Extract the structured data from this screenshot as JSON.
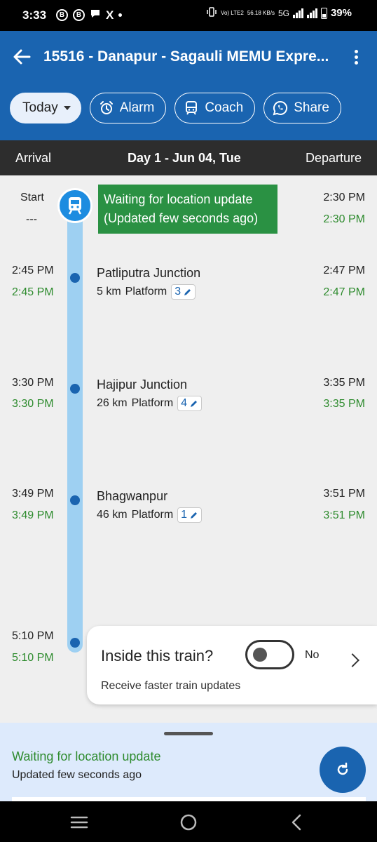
{
  "status_bar": {
    "time": "3:33",
    "network_small": "Vo) LTE2",
    "speed": "56.18 KB/s",
    "network": "5G",
    "battery": "39%"
  },
  "app_bar": {
    "title": "15516 - Danapur - Sagauli MEMU Expre...",
    "chips": {
      "today": "Today",
      "alarm": "Alarm",
      "coach": "Coach",
      "share": "Share"
    }
  },
  "day_header": {
    "arrival": "Arrival",
    "day": "Day 1 - Jun 04, Tue",
    "departure": "Departure"
  },
  "live_status": {
    "line1": "Waiting for location update",
    "line2": "(Updated few seconds ago)"
  },
  "stops": [
    {
      "arr_sched": "Start",
      "arr_actual": "---",
      "dep_sched": "2:30 PM",
      "dep_actual": "2:30 PM"
    },
    {
      "arr_sched": "2:45 PM",
      "arr_actual": "2:45 PM",
      "name": "Patliputra Junction",
      "distance": "5 km",
      "platform_label": "Platform",
      "platform": "3",
      "dep_sched": "2:47 PM",
      "dep_actual": "2:47 PM"
    },
    {
      "arr_sched": "3:30 PM",
      "arr_actual": "3:30 PM",
      "name": "Hajipur Junction",
      "distance": "26 km",
      "platform_label": "Platform",
      "platform": "4",
      "dep_sched": "3:35 PM",
      "dep_actual": "3:35 PM"
    },
    {
      "arr_sched": "3:49 PM",
      "arr_actual": "3:49 PM",
      "name": "Bhagwanpur",
      "distance": "46 km",
      "platform_label": "Platform",
      "platform": "1",
      "dep_sched": "3:51 PM",
      "dep_actual": "3:51 PM"
    },
    {
      "arr_sched": "5:10 PM",
      "arr_actual": "5:10 PM"
    }
  ],
  "inside_card": {
    "question": "Inside this train?",
    "toggle_value": "No",
    "subtitle": "Receive faster train updates"
  },
  "bottom_sheet": {
    "status": "Waiting for location update",
    "updated": "Updated few seconds ago"
  },
  "colors": {
    "primary": "#1a64b0",
    "green": "#2a9143",
    "track": "#9ed0f2",
    "sheet": "#ddeafc"
  }
}
